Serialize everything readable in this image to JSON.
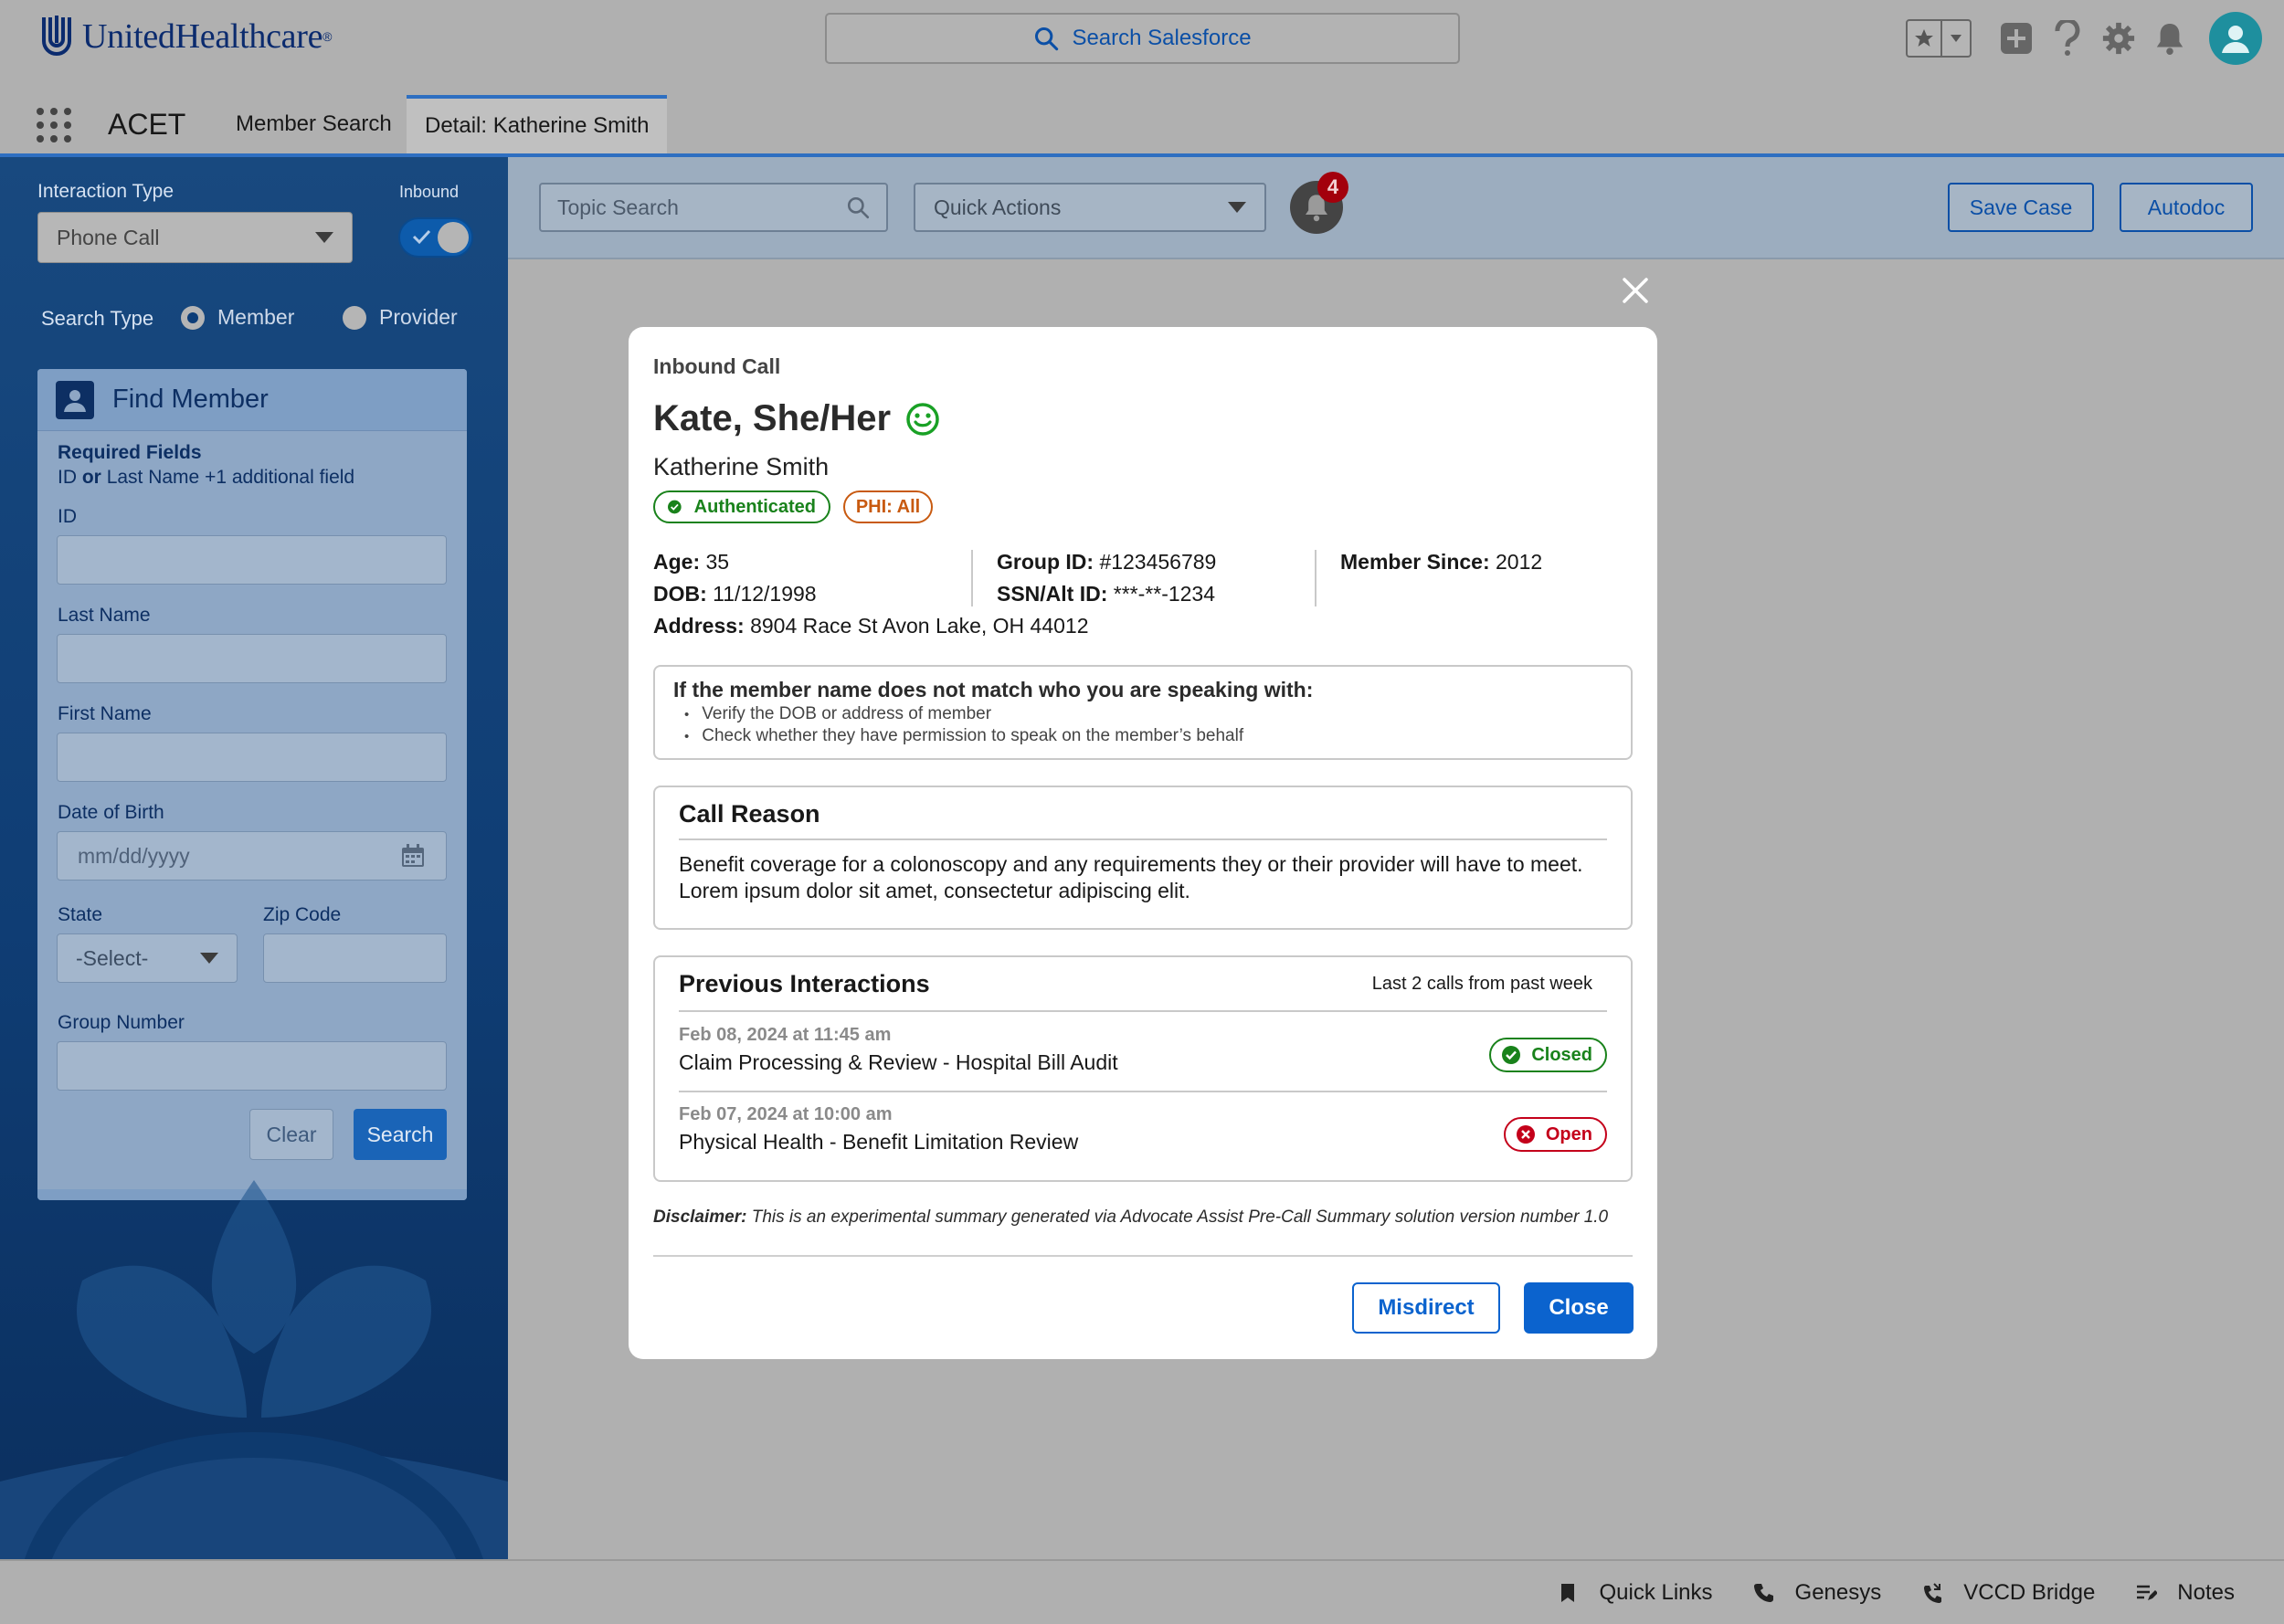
{
  "header": {
    "brand": "UnitedHealthcare",
    "search_label": "Search Salesforce"
  },
  "nav": {
    "app_name": "ACET",
    "tabs": [
      {
        "label": "Member Search"
      },
      {
        "label": "Detail:  Katherine Smith"
      }
    ]
  },
  "sidebar": {
    "interaction_type_label": "Interaction Type",
    "interaction_type_value": "Phone Call",
    "inbound_label": "Inbound",
    "search_type_label": "Search Type",
    "search_type_options": [
      "Member",
      "Provider"
    ],
    "find_member": {
      "title": "Find Member",
      "required_title": "Required Fields",
      "required_id": "ID",
      "required_or": "or",
      "required_rest": "Last Name +1 additional field",
      "id_label": "ID",
      "last_name_label": "Last Name",
      "first_name_label": "First Name",
      "dob_label": "Date of Birth",
      "dob_placeholder": "mm/dd/yyyy",
      "state_label": "State",
      "state_value": "-Select-",
      "zip_label": "Zip Code",
      "group_label": "Group Number",
      "clear_label": "Clear",
      "search_label": "Search"
    }
  },
  "actionbar": {
    "topic_placeholder": "Topic Search",
    "quick_actions": "Quick Actions",
    "notification_count": "4",
    "save_case": "Save Case",
    "autodoc": "Autodoc"
  },
  "modal": {
    "kicker": "Inbound Call",
    "preferred_name": "Kate, She/Her",
    "full_name": "Katherine Smith",
    "badge_auth": "Authenticated",
    "badge_phi": "PHI: All",
    "age_label": "Age:",
    "age_value": "35",
    "dob_label": "DOB:",
    "dob_value": "11/12/1998",
    "address_label": "Address:",
    "address_value": "8904 Race St Avon Lake,  OH 44012",
    "group_label": "Group ID:",
    "group_value": "#123456789",
    "ssn_label": "SSN/Alt ID:",
    "ssn_value": "***-**-1234",
    "since_label": "Member Since:",
    "since_value": "2012",
    "notice_title": "If the member name does not match who you are speaking with:",
    "notice_items": [
      "Verify the DOB or address of member",
      "Check whether they have permission to speak on the member’s behalf"
    ],
    "call_reason_title": "Call Reason",
    "call_reason_text": "Benefit coverage for a colonoscopy and any requirements they or their provider will have to meet. Lorem ipsum dolor sit amet, consectetur adipiscing elit.",
    "prev_title": "Previous Interactions",
    "prev_note": "Last 2 calls from past week",
    "interactions": [
      {
        "date": "Feb 08, 2024 at 11:45 am",
        "desc": "Claim Processing & Review - Hospital Bill Audit",
        "status": "Closed"
      },
      {
        "date": "Feb 07, 2024 at 10:00 am",
        "desc": "Physical Health - Benefit Limitation Review",
        "status": "Open"
      }
    ],
    "disclaimer_label": "Disclaimer:",
    "disclaimer_text": "This is an experimental summary generated via Advocate Assist Pre-Call Summary solution version number 1.0",
    "misdirect": "Misdirect",
    "close": "Close"
  },
  "utility": {
    "items": [
      "Quick Links",
      "Genesys",
      "VCCD Bridge",
      "Notes"
    ]
  },
  "colors": {
    "brand_navy": "#0b2b6e",
    "primary_blue": "#0b63ce",
    "success_green": "#19821b",
    "error_red": "#c4001a",
    "phi_orange": "#c85a10"
  }
}
